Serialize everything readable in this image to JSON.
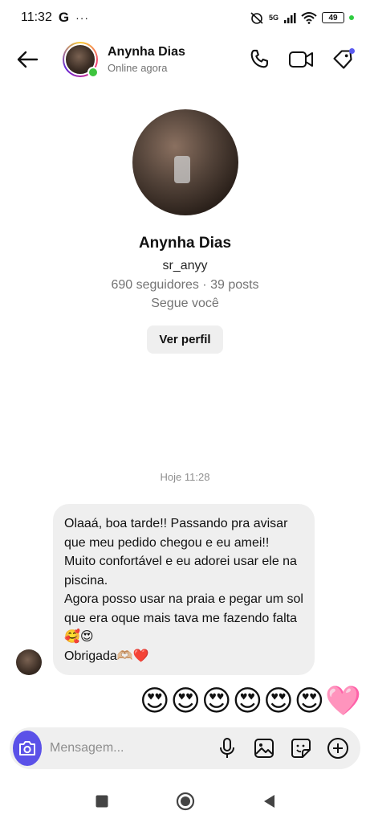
{
  "status_bar": {
    "time": "11:32",
    "google_glyph": "G",
    "more_dots": "···",
    "network": "5G",
    "battery": "49"
  },
  "header": {
    "name": "Anynha Dias",
    "status": "Online agora"
  },
  "profile": {
    "name": "Anynha Dias",
    "username": "sr_anyy",
    "stats": "690 seguidores · 39 posts",
    "follows_you": "Segue você",
    "view_profile_label": "Ver perfil"
  },
  "conversation": {
    "timestamp": "Hoje 11:28",
    "message": "Olaaá, boa tarde!! Passando pra avisar que meu pedido chegou e eu amei!! Muito confortável e eu adorei usar ele na piscina.\nAgora posso usar na praia e pegar um sol que era oque mais tava me fazendo falta🥰😍\nObrigada🫶🏼❤️",
    "reply": "😍😍😍😍😍😍🩷"
  },
  "composer": {
    "placeholder": "Mensagem..."
  },
  "icons": {
    "back": "arrow-left-icon",
    "call": "phone-icon",
    "video": "video-camera-icon",
    "tag": "tag-icon",
    "camera": "camera-icon",
    "mic": "microphone-icon",
    "gallery": "image-icon",
    "sticker": "sticker-icon",
    "add": "plus-circle-icon"
  },
  "colors": {
    "accent": "#5b51e8",
    "online": "#3ec43e",
    "bubble": "#efefef",
    "muted_text": "#737373"
  }
}
